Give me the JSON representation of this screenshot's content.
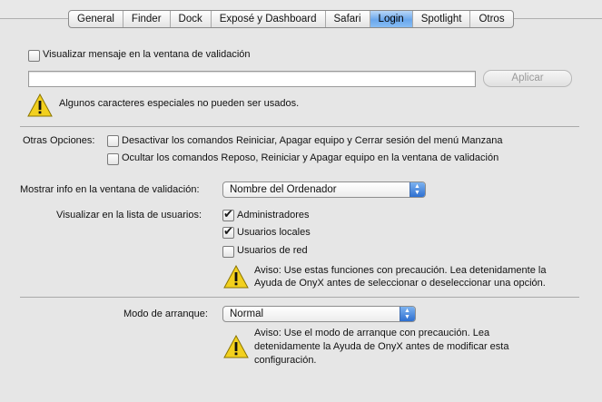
{
  "tabs": [
    "General",
    "Finder",
    "Dock",
    "Exposé y Dashboard",
    "Safari",
    "Login",
    "Spotlight",
    "Otros"
  ],
  "selected_tab": "Login",
  "login_message": {
    "checkbox_label": "Visualizar mensaje en la ventana de validación",
    "checked": false,
    "field_value": "",
    "apply_label": "Aplicar",
    "warning": "Algunos caracteres especiales no pueden ser usados."
  },
  "other_options": {
    "label": "Otras Opciones:",
    "items": [
      {
        "label": "Desactivar los comandos Reiniciar, Apagar equipo y Cerrar sesión del menú Manzana",
        "checked": false
      },
      {
        "label": "Ocultar los comandos Reposo, Reiniciar y Apagar equipo en la ventana de validación",
        "checked": false
      }
    ]
  },
  "show_info": {
    "label": "Mostrar info en la ventana de validación:",
    "value": "Nombre del Ordenador"
  },
  "user_list": {
    "label": "Visualizar en la lista de usuarios:",
    "items": [
      {
        "label": "Administradores",
        "checked": true
      },
      {
        "label": "Usuarios locales",
        "checked": true
      },
      {
        "label": "Usuarios de red",
        "checked": false
      }
    ],
    "warning_line1": "Aviso: Use estas funciones con precaución. Lea detenidamente la",
    "warning_line2": "Ayuda de OnyX antes de seleccionar o deseleccionar una opción."
  },
  "startup_mode": {
    "label": "Modo de arranque:",
    "value": "Normal",
    "warning_line1": "Aviso: Use el modo de arranque con precaución. Lea",
    "warning_line2": "detenidamente la Ayuda de  OnyX antes de modificar esta",
    "warning_line3": "configuración."
  },
  "colors": {
    "selected_tab": "#6aa7ec",
    "popup_arrows": "#2e6fd0",
    "warning": "#f2d01e"
  }
}
